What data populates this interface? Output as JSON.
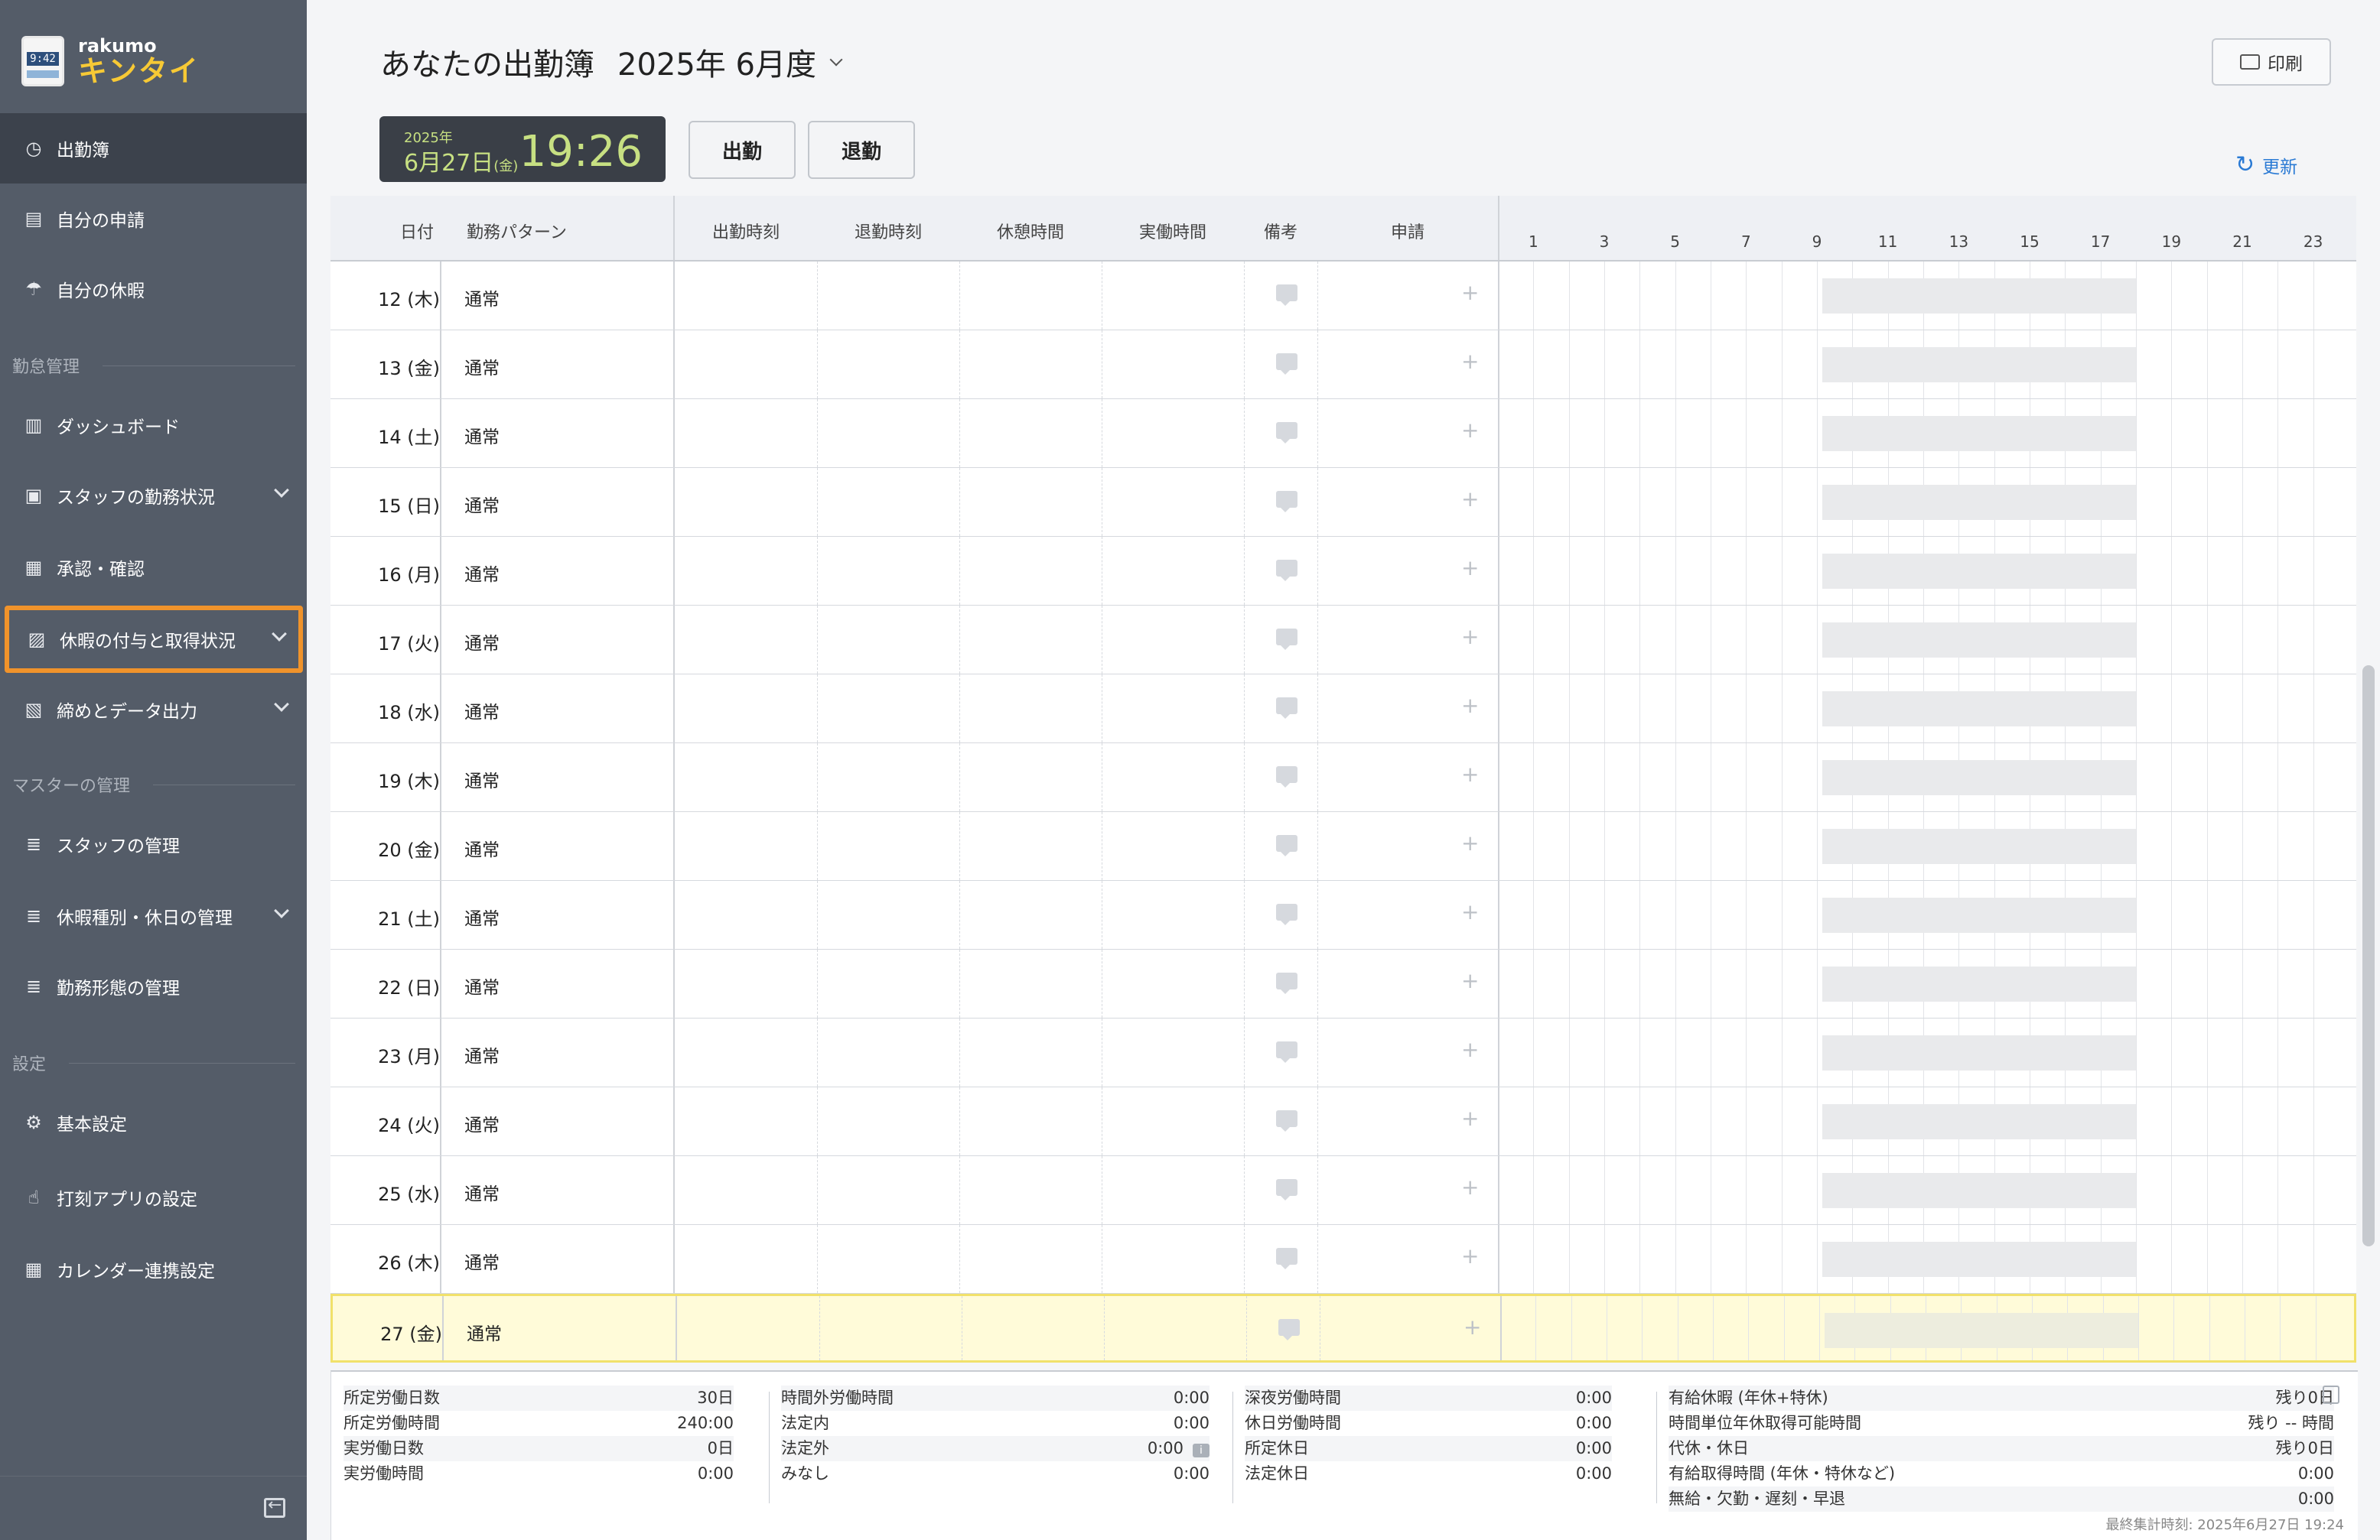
{
  "app": {
    "brand_small": "rakumo",
    "brand_big": "キンタイ",
    "logo_time": "9:42"
  },
  "sidebar": {
    "items_top": [
      {
        "label": "出勤簿",
        "icon": "clock-icon"
      },
      {
        "label": "自分の申請",
        "icon": "document-icon"
      },
      {
        "label": "自分の休暇",
        "icon": "vacation-icon"
      }
    ],
    "section_attendance": "勤怠管理",
    "items_attendance": [
      {
        "label": "ダッシュボード",
        "icon": "chart-icon"
      },
      {
        "label": "スタッフの勤務状況",
        "icon": "clipboard-icon"
      },
      {
        "label": "承認・確認",
        "icon": "approve-icon"
      },
      {
        "label": "休暇の付与と取得状況",
        "icon": "gift-icon"
      },
      {
        "label": "締めとデータ出力",
        "icon": "export-icon"
      }
    ],
    "section_master": "マスターの管理",
    "items_master": [
      {
        "label": "スタッフの管理",
        "icon": "database-icon"
      },
      {
        "label": "休暇種別・休日の管理",
        "icon": "database-icon"
      },
      {
        "label": "勤務形態の管理",
        "icon": "database-icon"
      }
    ],
    "section_settings": "設定",
    "items_settings": [
      {
        "label": "基本設定",
        "icon": "gear-icon"
      },
      {
        "label": "打刻アプリの設定",
        "icon": "tap-icon"
      },
      {
        "label": "カレンダー連携設定",
        "icon": "calendar-icon"
      }
    ]
  },
  "header": {
    "title": "あなたの出勤簿",
    "period": "2025年 6月度",
    "print_label": "印刷",
    "refresh_label": "更新"
  },
  "clock": {
    "year": "2025年",
    "date": "6月27日",
    "weekday": "(金)",
    "time": "19:26"
  },
  "buttons": {
    "clock_in": "出勤",
    "clock_out": "退勤"
  },
  "table": {
    "headers": {
      "date": "日付",
      "pattern": "勤務パターン",
      "in": "出勤時刻",
      "out": "退勤時刻",
      "break": "休憩時間",
      "work": "実働時間",
      "memo": "備考",
      "request": "申請"
    },
    "hours": [
      "1",
      "3",
      "5",
      "7",
      "9",
      "11",
      "13",
      "15",
      "17",
      "19",
      "21",
      "23"
    ],
    "rows": [
      {
        "date": "12 (木)",
        "pattern": "通常"
      },
      {
        "date": "13 (金)",
        "pattern": "通常"
      },
      {
        "date": "14 (土)",
        "pattern": "通常"
      },
      {
        "date": "15 (日)",
        "pattern": "通常"
      },
      {
        "date": "16 (月)",
        "pattern": "通常"
      },
      {
        "date": "17 (火)",
        "pattern": "通常"
      },
      {
        "date": "18 (水)",
        "pattern": "通常"
      },
      {
        "date": "19 (木)",
        "pattern": "通常"
      },
      {
        "date": "20 (金)",
        "pattern": "通常"
      },
      {
        "date": "21 (土)",
        "pattern": "通常"
      },
      {
        "date": "22 (日)",
        "pattern": "通常"
      },
      {
        "date": "23 (月)",
        "pattern": "通常"
      },
      {
        "date": "24 (火)",
        "pattern": "通常"
      },
      {
        "date": "25 (水)",
        "pattern": "通常"
      },
      {
        "date": "26 (木)",
        "pattern": "通常"
      },
      {
        "date": "27 (金)",
        "pattern": "通常",
        "today": true
      }
    ]
  },
  "summary": {
    "col1": [
      {
        "label": "所定労働日数",
        "value": "30日"
      },
      {
        "label": "所定労働時間",
        "value": "240:00"
      },
      {
        "label": "実労働日数",
        "value": "0日"
      },
      {
        "label": "実労働時間",
        "value": "0:00"
      }
    ],
    "col2": [
      {
        "label": "時間外労働時間",
        "value": "0:00"
      },
      {
        "label": "法定内",
        "value": "0:00"
      },
      {
        "label": "法定外",
        "value": "0:00"
      },
      {
        "label": "みなし",
        "value": "0:00"
      }
    ],
    "col3": [
      {
        "label": "深夜労働時間",
        "value": "0:00"
      },
      {
        "label": "休日労働時間",
        "value": "0:00"
      },
      {
        "label": "所定休日",
        "value": "0:00"
      },
      {
        "label": "法定休日",
        "value": "0:00"
      }
    ],
    "col4": [
      {
        "label": "有給休暇 (年休+特休)",
        "value": "残り0日"
      },
      {
        "label": "時間単位年休取得可能時間",
        "value": "残り -- 時間"
      },
      {
        "label": "代休・休日",
        "value": "残り0日"
      },
      {
        "label": "有給取得時間 (年休・特休など)",
        "value": "0:00"
      },
      {
        "label": "無給・欠勤・遅刻・早退",
        "value": "0:00"
      }
    ],
    "last_aggregated": "最終集計時刻: 2025年6月27日 19:24"
  },
  "colors": {
    "sidebar": "#545c68",
    "active": "#3c424c",
    "highlight": "#f0932b",
    "clock_text": "#c7e082",
    "accent": "#2a7ad4"
  }
}
